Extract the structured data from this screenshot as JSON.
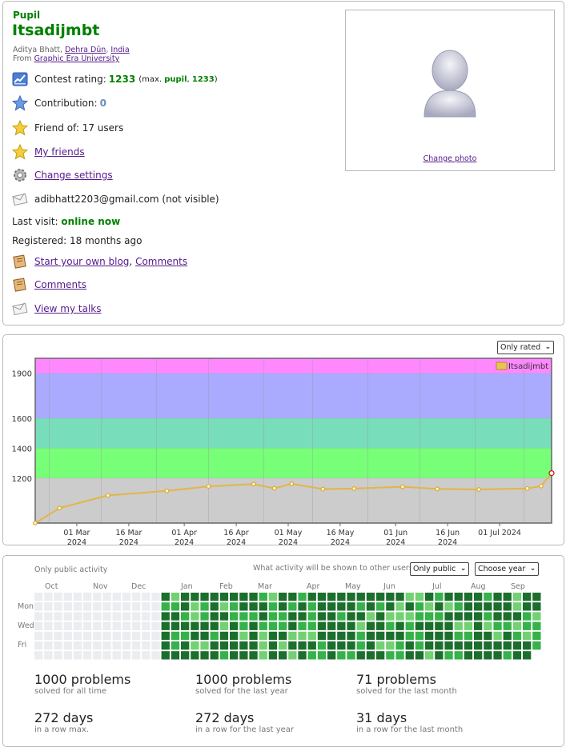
{
  "profile": {
    "rank": "Pupil",
    "handle": "Itsadijmbt",
    "name_prefix": "Aditya Bhatt, ",
    "city": "Dehra Dūn",
    "country": "India",
    "from_prefix": "From ",
    "organization": "Graphic Era University",
    "rating_label": "Contest rating: ",
    "rating": "1233",
    "max_prefix": "(max. ",
    "max_rank": "pupil",
    "max_rating": "1233",
    "max_suffix": ")",
    "contribution_label": "Contribution: ",
    "contribution": "0",
    "friend_of": "Friend of: 17 users",
    "my_friends": "My friends",
    "change_settings": "Change settings",
    "email": "adibhatt2203@gmail.com (not visible)",
    "last_visit_label": "Last visit: ",
    "last_visit": "online now",
    "registered": "Registered: 18 months ago",
    "blog": "Start your own blog",
    "comments": "Comments",
    "talks": "View my talks",
    "change_photo": "Change photo"
  },
  "rating_chart": {
    "filter": "Only rated",
    "legend": "Itsadijmbt"
  },
  "chart_data": {
    "type": "line",
    "title": "",
    "xlabel": "",
    "ylabel": "",
    "series": [
      {
        "name": "Itsadijmbt",
        "x": [
          "2024-02-18",
          "2024-02-25",
          "2024-03-10",
          "2024-03-27",
          "2024-04-08",
          "2024-04-21",
          "2024-04-27",
          "2024-05-02",
          "2024-05-11",
          "2024-05-20",
          "2024-06-03",
          "2024-06-13",
          "2024-06-25",
          "2024-07-09",
          "2024-07-13",
          "2024-07-16"
        ],
        "y": [
          900,
          1000,
          1085,
          1115,
          1145,
          1160,
          1132,
          1162,
          1127,
          1130,
          1142,
          1128,
          1124,
          1131,
          1147,
          1233
        ]
      }
    ],
    "x_ticks": [
      "01 Mar\n2024",
      "16 Mar\n2024",
      "01 Apr\n2024",
      "16 Apr\n2024",
      "01 May\n2024",
      "16 May\n2024",
      "01 Jun\n2024",
      "16 Jun\n2024",
      "01 Jul 2024"
    ],
    "y_ticks": [
      1200,
      1400,
      1600,
      1900
    ],
    "rank_bands": [
      {
        "from": 0,
        "to": 1200,
        "color": "#cccccc"
      },
      {
        "from": 1200,
        "to": 1400,
        "color": "#77ff77"
      },
      {
        "from": 1400,
        "to": 1600,
        "color": "#77ddbb"
      },
      {
        "from": 1600,
        "to": 1900,
        "color": "#aaaaff"
      },
      {
        "from": 1900,
        "to": 2000,
        "color": "#ff88ff"
      }
    ],
    "grid": true,
    "legend_position": "top-right"
  },
  "activity": {
    "only_public": "Only public activity",
    "question": "What activity will be shown to other users:",
    "visibility_select": "Only public",
    "year_select": "Choose year",
    "months": [
      "Oct",
      "Nov",
      "Dec",
      "Jan",
      "Feb",
      "Mar",
      "Apr",
      "May",
      "Jun",
      "Jul",
      "Aug",
      "Sep"
    ],
    "days": [
      "Mon",
      "Wed",
      "Fri"
    ],
    "stats": [
      {
        "value": "1000 problems",
        "label": "solved for all time"
      },
      {
        "value": "1000 problems",
        "label": "solved for the last year"
      },
      {
        "value": "71 problems",
        "label": "solved for the last month"
      },
      {
        "value": "272 days",
        "label": "in a row max."
      },
      {
        "value": "272 days",
        "label": "in a row for the last year"
      },
      {
        "value": "31 days",
        "label": "in a row for the last month"
      }
    ]
  },
  "colors": {
    "green_rank": "#008000",
    "link": "#551a8b",
    "cell_empty": "#ebedf0",
    "cell_light": "#73d173",
    "cell_mid": "#35b24a",
    "cell_dark": "#1c6e2d",
    "line": "#e8b74a"
  }
}
